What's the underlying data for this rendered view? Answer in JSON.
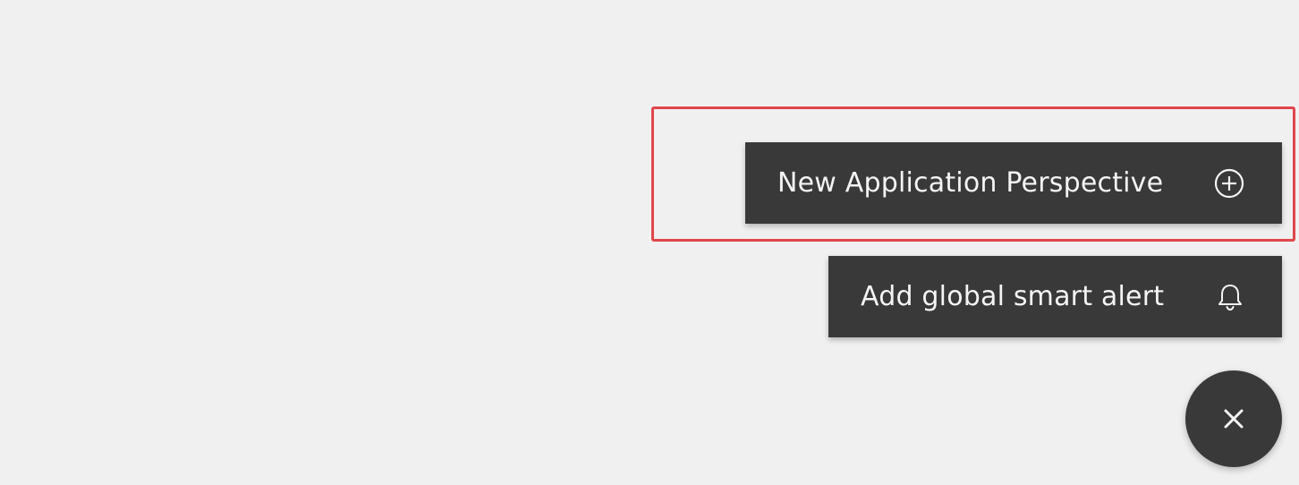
{
  "fab_menu": {
    "items": [
      {
        "label": "New Application Perspective",
        "icon": "add-circle-icon"
      },
      {
        "label": "Add global smart alert",
        "icon": "bell-icon"
      }
    ],
    "close_icon": "close-icon"
  },
  "colors": {
    "background": "#f0f0f0",
    "menu_item_bg": "#393939",
    "menu_item_text": "#f4f4f4",
    "highlight": "#e0464b"
  }
}
